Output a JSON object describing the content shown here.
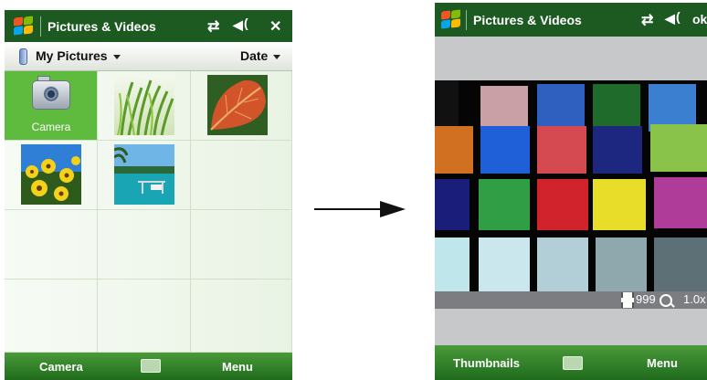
{
  "left": {
    "title": "Pictures & Videos",
    "icons": {
      "connectivity": "⇄",
      "volume": "◀",
      "close": "✕"
    },
    "folder": "My Pictures",
    "sort": "Date",
    "camera_label": "Camera",
    "softkeys": {
      "left": "Camera",
      "right": "Menu"
    }
  },
  "right": {
    "title": "Pictures & Videos",
    "icons": {
      "connectivity": "⇄",
      "volume": "◀"
    },
    "ok": "ok",
    "counter": "999",
    "zoom": "1.0x",
    "softkeys": {
      "left": "Thumbnails",
      "right": "Menu"
    }
  },
  "colors": {
    "titlebar": "#1d5a22",
    "selection": "#5fbb3d",
    "softkeybar": "#2b7a24",
    "swatches": [
      "#111111",
      "#c9a0a5",
      "#2f5fbf",
      "#1e6b2c",
      "#3a7fd0",
      "#2a2a2a",
      "#d07020",
      "#1f5fd8",
      "#d54a50",
      "#1d2780",
      "#8ac34a",
      "#2a2a2a",
      "#1a1d7a",
      "#2f9e45",
      "#d0232c",
      "#e8de2a",
      "#b03c9a",
      "#2a2a2a",
      "#bfe6ea",
      "#c9e7ec",
      "#b2ced6",
      "#8ea8ae",
      "#5c7075",
      "#2a2a2a"
    ]
  }
}
